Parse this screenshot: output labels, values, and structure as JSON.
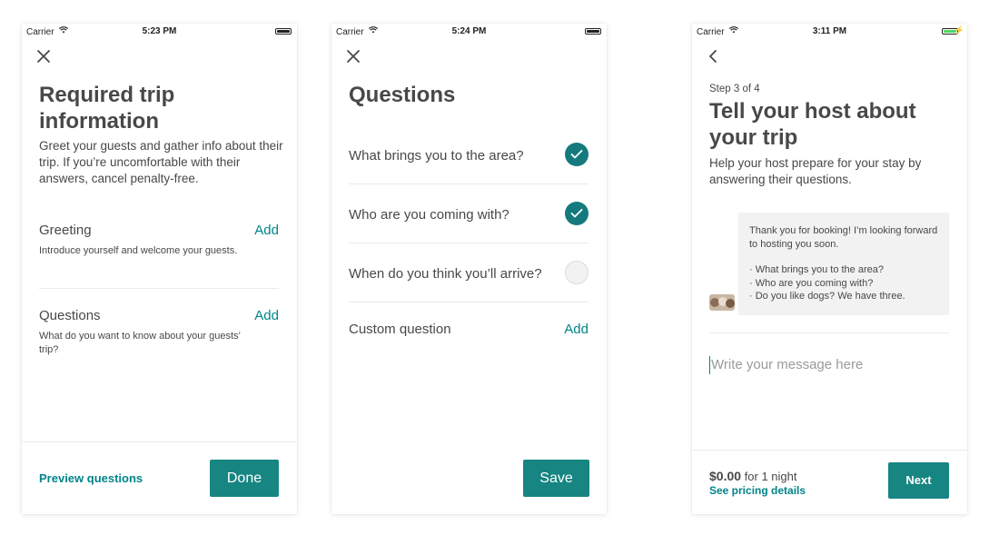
{
  "screens": [
    {
      "status": {
        "carrier": "Carrier",
        "time": "5:23 PM"
      },
      "title": "Required trip information",
      "subtitle": "Greet your guests and gather info about their trip. If you’re uncomfortable with their answers, cancel penalty-free.",
      "rows": [
        {
          "label": "Greeting",
          "action": "Add",
          "description": "Introduce yourself and welcome your guests."
        },
        {
          "label": "Questions",
          "action": "Add",
          "description": "What do you want to know about your guests’ trip?"
        }
      ],
      "footer": {
        "link": "Preview questions",
        "button": "Done"
      }
    },
    {
      "status": {
        "carrier": "Carrier",
        "time": "5:24 PM"
      },
      "title": "Questions",
      "questions": [
        {
          "text": "What brings you to the area?",
          "checked": true
        },
        {
          "text": "Who are you coming with?",
          "checked": true
        },
        {
          "text": "When do you think you’ll arrive?",
          "checked": false
        }
      ],
      "custom": {
        "label": "Custom question",
        "action": "Add"
      },
      "footer": {
        "button": "Save"
      }
    },
    {
      "status": {
        "carrier": "Carrier",
        "time": "3:11 PM"
      },
      "step": "Step 3 of 4",
      "title": "Tell your host about your trip",
      "subtitle": "Help your host prepare for your stay by answering their questions.",
      "host_message": {
        "intro": "Thank you for booking! I’m looking forward to hosting you soon.",
        "lines": [
          "· What brings you to the area?",
          "· Who are you coming with?",
          "· Do you like dogs? We have three."
        ]
      },
      "input": {
        "placeholder": "Write your message here"
      },
      "footer": {
        "price": "$0.00",
        "price_suffix": " for 1 night",
        "link": "See pricing details",
        "button": "Next"
      }
    }
  ],
  "colors": {
    "accent": "#008489",
    "button": "#178582",
    "text": "#484848",
    "divider": "#ebebeb",
    "battery_charging": "#4cd964"
  }
}
